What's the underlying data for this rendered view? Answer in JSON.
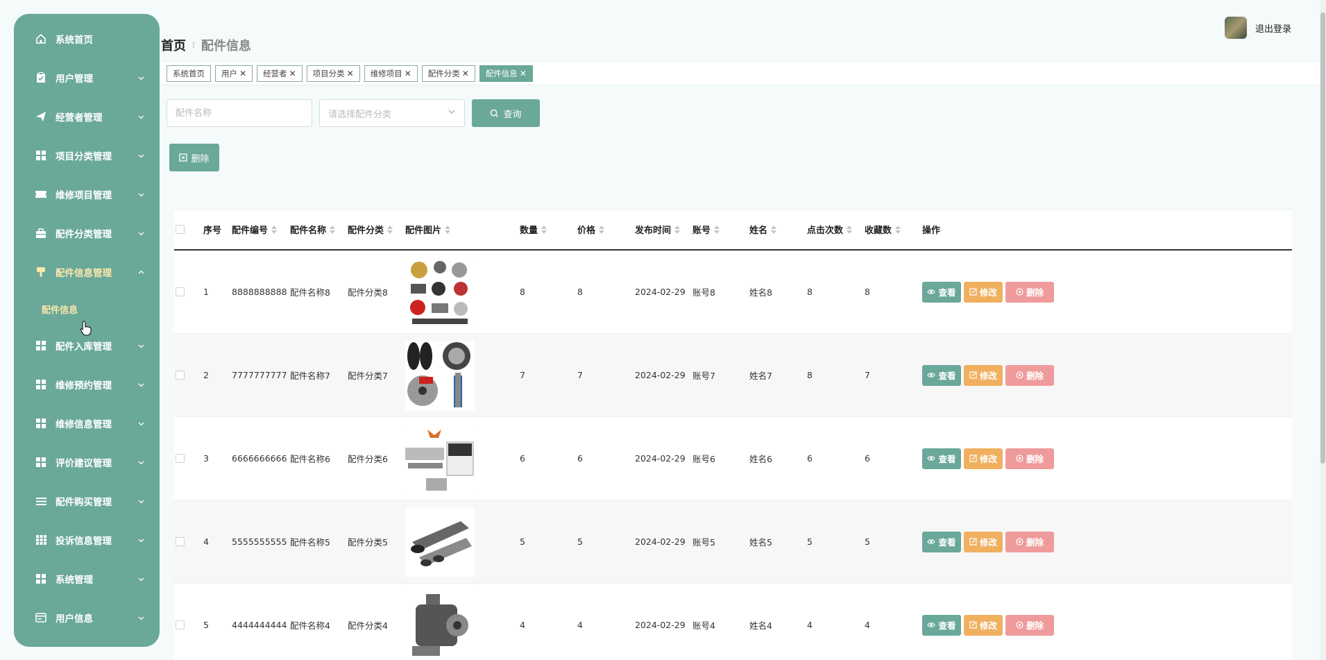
{
  "sidebar": {
    "items": [
      {
        "label": "系统首页",
        "icon": "home-icon",
        "has_arrow": false
      },
      {
        "label": "用户管理",
        "icon": "clipboard-icon",
        "has_arrow": true
      },
      {
        "label": "经营者管理",
        "icon": "send-icon",
        "has_arrow": true
      },
      {
        "label": "项目分类管理",
        "icon": "grid-icon",
        "has_arrow": true
      },
      {
        "label": "维修项目管理",
        "icon": "ticket-icon",
        "has_arrow": true
      },
      {
        "label": "配件分类管理",
        "icon": "briefcase-icon",
        "has_arrow": true
      },
      {
        "label": "配件信息管理",
        "icon": "brush-icon",
        "has_arrow": true,
        "expanded": true
      },
      {
        "label": "配件入库管理",
        "icon": "grid-icon",
        "has_arrow": true
      },
      {
        "label": "维修预约管理",
        "icon": "grid-icon",
        "has_arrow": true
      },
      {
        "label": "维修信息管理",
        "icon": "grid-icon",
        "has_arrow": true
      },
      {
        "label": "评价建议管理",
        "icon": "grid-icon",
        "has_arrow": true
      },
      {
        "label": "配件购买管理",
        "icon": "list-icon",
        "has_arrow": true
      },
      {
        "label": "投诉信息管理",
        "icon": "table-icon",
        "has_arrow": true
      },
      {
        "label": "系统管理",
        "icon": "grid-icon",
        "has_arrow": true
      },
      {
        "label": "用户信息",
        "icon": "card-icon",
        "has_arrow": true
      }
    ],
    "submenu": {
      "label": "配件信息"
    }
  },
  "header": {
    "breadcrumb_home": "首页",
    "breadcrumb_sep": "⁝",
    "breadcrumb_current": "配件信息",
    "logout_label": "退出登录"
  },
  "tabs": [
    {
      "label": "系统首页",
      "closable": false
    },
    {
      "label": "用户",
      "closable": true
    },
    {
      "label": "经营者",
      "closable": true
    },
    {
      "label": "项目分类",
      "closable": true
    },
    {
      "label": "维修项目",
      "closable": true
    },
    {
      "label": "配件分类",
      "closable": true
    },
    {
      "label": "配件信息",
      "closable": true,
      "active": true
    }
  ],
  "search": {
    "name_placeholder": "配件名称",
    "category_placeholder": "请选择配件分类",
    "query_label": "查询"
  },
  "actions": {
    "delete_label": "删除"
  },
  "table": {
    "columns": [
      "序号",
      "配件编号",
      "配件名称",
      "配件分类",
      "配件图片",
      "数量",
      "价格",
      "发布时间",
      "账号",
      "姓名",
      "点击次数",
      "收藏数",
      "操作"
    ],
    "rows": [
      {
        "idx": "1",
        "code": "8888888888",
        "name": "配件名称8",
        "category": "配件分类8",
        "image": "assorted-parts",
        "qty": "8",
        "price": "8",
        "date": "2024-02-29",
        "account": "账号8",
        "person": "姓名8",
        "clicks": "8",
        "favs": "8"
      },
      {
        "idx": "2",
        "code": "7777777777",
        "name": "配件名称7",
        "category": "配件分类7",
        "image": "tires-brakes",
        "qty": "7",
        "price": "7",
        "date": "2024-02-29",
        "account": "账号7",
        "person": "姓名7",
        "clicks": "8",
        "favs": "7"
      },
      {
        "idx": "3",
        "code": "6666666666",
        "name": "配件名称6",
        "category": "配件分类6",
        "image": "truck-parts",
        "qty": "6",
        "price": "6",
        "date": "2024-02-29",
        "account": "账号6",
        "person": "姓名6",
        "clicks": "6",
        "favs": "6"
      },
      {
        "idx": "4",
        "code": "5555555555",
        "name": "配件名称5",
        "category": "配件分类5",
        "image": "exhaust",
        "qty": "5",
        "price": "5",
        "date": "2024-02-29",
        "account": "账号5",
        "person": "姓名5",
        "clicks": "5",
        "favs": "5"
      },
      {
        "idx": "5",
        "code": "4444444444",
        "name": "配件名称4",
        "category": "配件分类4",
        "image": "gearbox",
        "qty": "4",
        "price": "4",
        "date": "2024-02-29",
        "account": "账号4",
        "person": "姓名4",
        "clicks": "4",
        "favs": "4"
      }
    ],
    "ops": {
      "view": "查看",
      "edit": "修改",
      "delete": "删除"
    }
  },
  "colors": {
    "primary": "#6aa89a",
    "warning": "#f0b060",
    "danger": "#ef9b9b",
    "highlight": "#fbe7a8"
  }
}
